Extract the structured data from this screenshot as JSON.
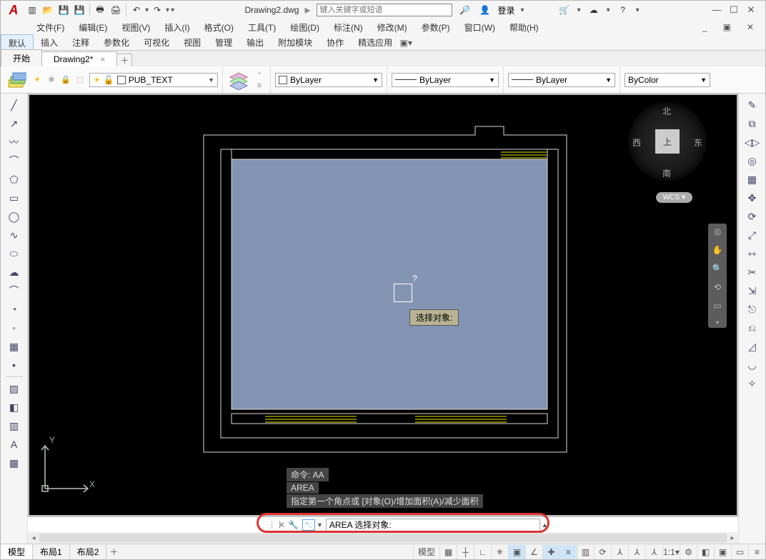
{
  "app": {
    "logo": "A"
  },
  "title": {
    "filename": "Drawing2.dwg",
    "search_placeholder": "键入关键字或短语",
    "login": "登录"
  },
  "winicons": {
    "qmark": "?",
    "min": "—",
    "max": "☐",
    "close": "✕"
  },
  "menu": {
    "items": [
      "文件(F)",
      "编辑(E)",
      "视图(V)",
      "插入(I)",
      "格式(O)",
      "工具(T)",
      "绘图(D)",
      "标注(N)",
      "修改(M)",
      "参数(P)",
      "窗口(W)",
      "帮助(H)"
    ]
  },
  "ribbon_tabs": {
    "items": [
      "默认",
      "插入",
      "注释",
      "参数化",
      "可视化",
      "视图",
      "管理",
      "输出",
      "附加模块",
      "协作",
      "精选应用"
    ],
    "active": 0
  },
  "filetabs": {
    "items": [
      {
        "label": "开始",
        "active": false
      },
      {
        "label": "Drawing2*",
        "active": true
      }
    ]
  },
  "layer": {
    "current": "PUB_TEXT"
  },
  "props": {
    "color": "ByLayer",
    "linetype": "ByLayer",
    "lineweight": "ByLayer",
    "plotstyle": "ByColor"
  },
  "viewcube": {
    "n": "北",
    "s": "南",
    "e": "东",
    "w": "西",
    "top": "上",
    "wcs": "WCS"
  },
  "tooltip": {
    "text": "选择对象:",
    "qmark": "?"
  },
  "ucs": {
    "x": "X",
    "y": "Y"
  },
  "cmdhist": {
    "l1": "命令: AA",
    "l2": "AREA",
    "l3": "指定第一个角点或 [对象(O)/增加面积(A)/减少面积"
  },
  "cmdline": {
    "prefix": ">_",
    "value": "AREA 选择对象:"
  },
  "layouts": {
    "items": [
      "模型",
      "布局1",
      "布局2"
    ],
    "active": 0
  },
  "status": {
    "model": "模型",
    "zoom": "1:1"
  }
}
